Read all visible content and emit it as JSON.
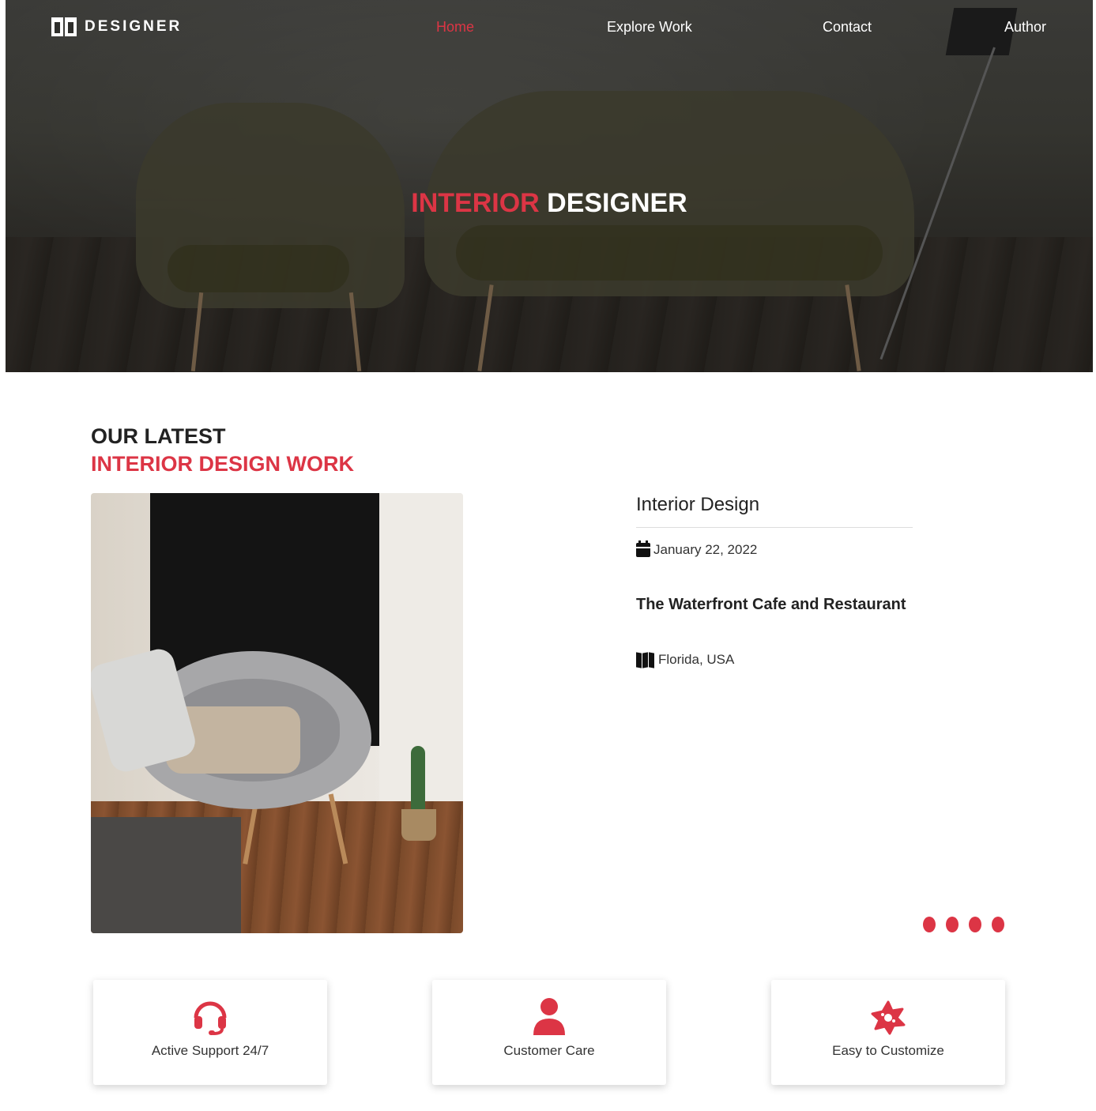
{
  "brand": {
    "name": "DESIGNER",
    "logo_icon": "designer-logo-icon"
  },
  "nav": {
    "items": [
      {
        "label": "Home",
        "active": true
      },
      {
        "label": "Explore Work",
        "active": false
      },
      {
        "label": "Contact",
        "active": false
      },
      {
        "label": "Author",
        "active": false
      }
    ]
  },
  "hero": {
    "title_accent": "INTERIOR",
    "title_rest": " DESIGNER"
  },
  "latest": {
    "heading_line1": "OUR LATEST",
    "heading_line2": "INTERIOR DESIGN WORK",
    "card": {
      "title": "Interior Design",
      "date_icon": "calendar-icon",
      "date": "January 22, 2022",
      "project": "The Waterfront Cafe and Restaurant",
      "location_icon": "map-icon",
      "location": "Florida, USA"
    },
    "carousel_dots": 4
  },
  "features": [
    {
      "icon": "headset-icon",
      "label": "Active Support 24/7"
    },
    {
      "icon": "user-icon",
      "label": "Customer Care"
    },
    {
      "icon": "cog-star-icon",
      "label": "Easy to Customize"
    }
  ],
  "colors": {
    "accent": "#dc3545",
    "text": "#222222",
    "hero_overlay": "#2e2e2b"
  }
}
